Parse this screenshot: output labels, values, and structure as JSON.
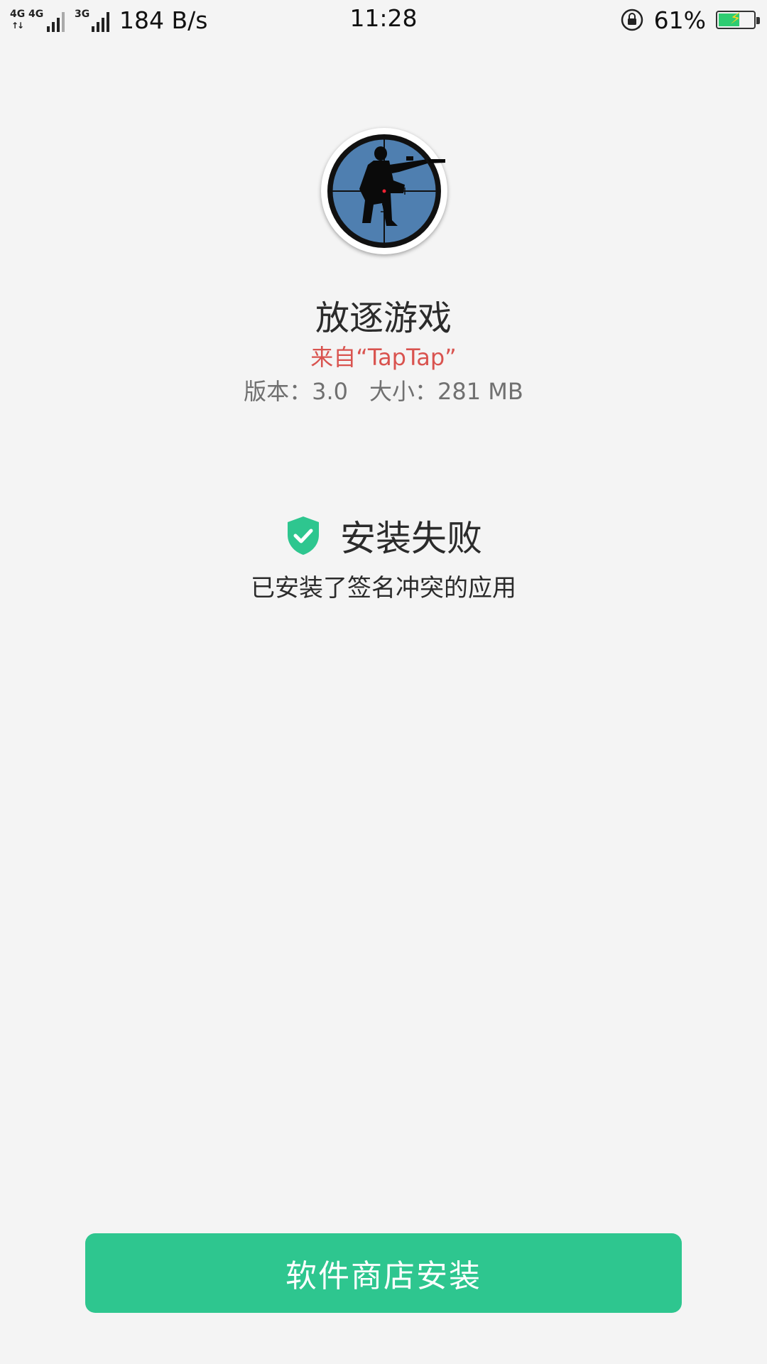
{
  "status_bar": {
    "sim1_tech": "4G",
    "sim1_tech2": "4G",
    "sim2_tech": "3G",
    "net_speed": "184 B/s",
    "time": "11:28",
    "battery_percent": "61%",
    "battery_level": 0.61,
    "icons": [
      "rotation-lock-icon",
      "battery-charging-icon"
    ]
  },
  "app": {
    "icon": "sniper-scope-icon",
    "name": "放逐游戏",
    "source": "来自“TapTap”",
    "version_label": "版本：3.0",
    "size_label": "大小：281 MB"
  },
  "install_status": {
    "icon": "shield-check-icon",
    "title": "安装失败",
    "detail": "已安装了签名冲突的应用"
  },
  "actions": {
    "store_install_label": "软件商店安装"
  },
  "colors": {
    "accent": "#2ec68f",
    "source_text": "#d9534f",
    "background": "#f4f4f4"
  }
}
